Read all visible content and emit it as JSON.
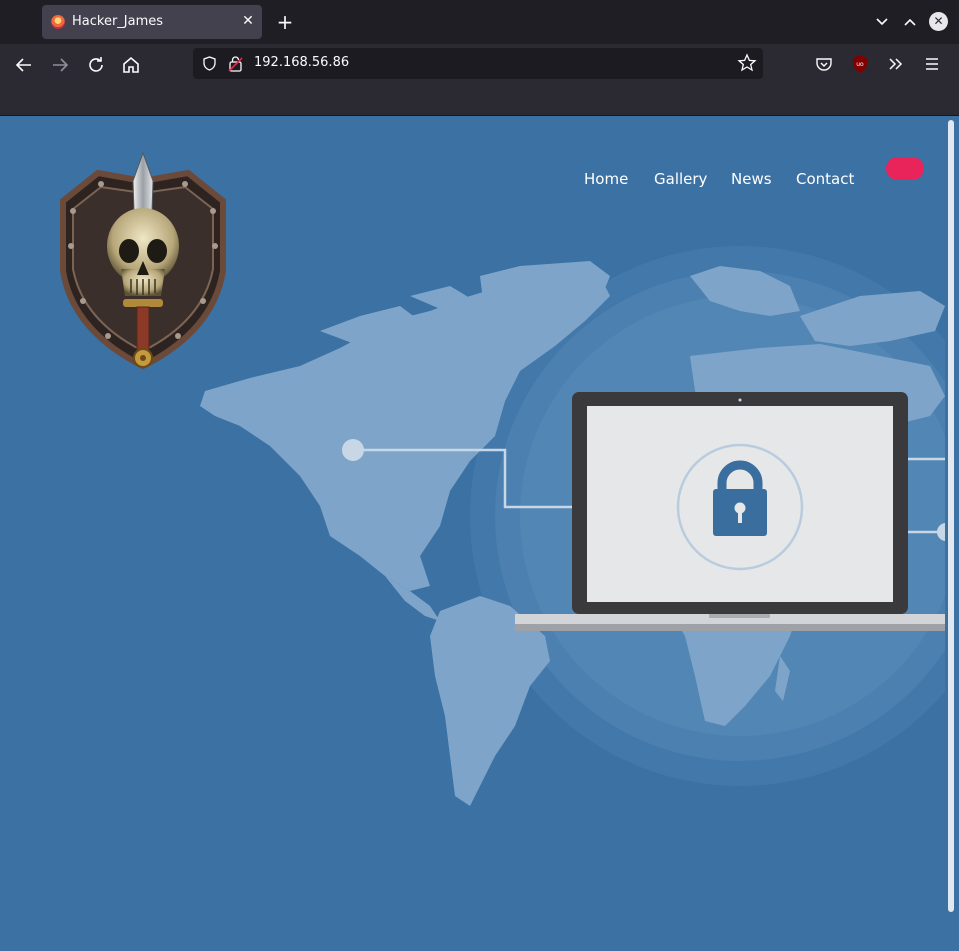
{
  "browser": {
    "tab": {
      "title": "Hacker_James",
      "close_glyph": "✕",
      "favicon": "firefox-favicon"
    },
    "new_tab_glyph": "+",
    "window_controls": {
      "minimize_glyph": "⌄",
      "maximize_glyph": "⌃",
      "close_glyph": "✕"
    },
    "navigation": {
      "back_glyph": "←",
      "forward_glyph": "→",
      "reload_glyph": "↻",
      "home_glyph": "⌂"
    },
    "url": "192.168.56.86",
    "bookmark_star_glyph": "☆",
    "toolbar": {
      "pocket_icon": "pocket-icon",
      "ublock_icon": "ublock-origin-icon",
      "extensions_glyph": "»",
      "menu_glyph": "≡"
    }
  },
  "site": {
    "nav": [
      {
        "label": "Home"
      },
      {
        "label": "Gallery"
      },
      {
        "label": "News"
      },
      {
        "label": "Contact"
      }
    ],
    "cta_color": "#e8245a",
    "logo": "skull-shield-emblem",
    "hero": "world-map-laptop-padlock-illustration"
  },
  "colors": {
    "page_background": "#3b71a3",
    "map_land": "#7ea5c9",
    "chrome_dark": "#1f1e25",
    "chrome_mid": "#2b2a33"
  }
}
